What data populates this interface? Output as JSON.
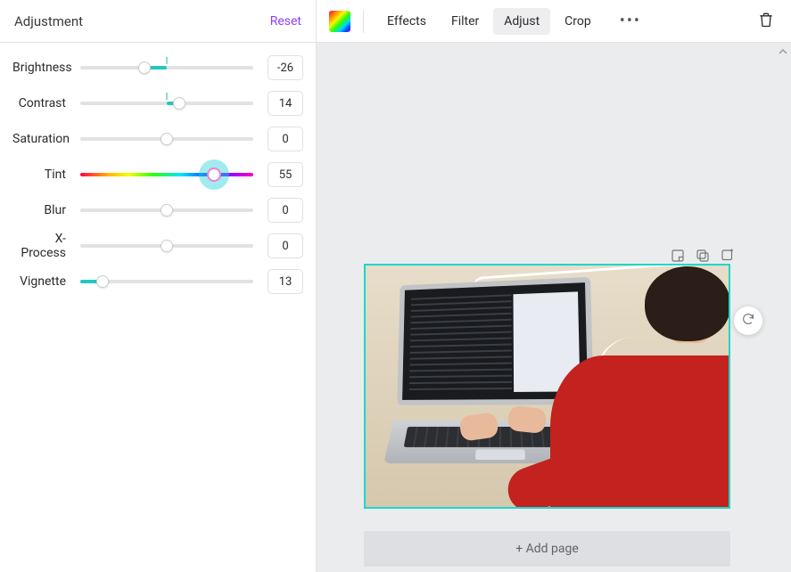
{
  "panel": {
    "title": "Adjustment",
    "reset_label": "Reset"
  },
  "sliders": {
    "brightness": {
      "label": "Brightness",
      "value": "-26",
      "min": -100,
      "max": 100,
      "v": -26,
      "origin": "center"
    },
    "contrast": {
      "label": "Contrast",
      "value": "14",
      "min": -100,
      "max": 100,
      "v": 14,
      "origin": "center"
    },
    "saturation": {
      "label": "Saturation",
      "value": "0",
      "min": -100,
      "max": 100,
      "v": 0,
      "origin": "center"
    },
    "tint": {
      "label": "Tint",
      "value": "55",
      "min": -100,
      "max": 100,
      "v": 55,
      "origin": "left"
    },
    "blur": {
      "label": "Blur",
      "value": "0",
      "min": -100,
      "max": 100,
      "v": 0,
      "origin": "center"
    },
    "xprocess": {
      "label": "X-Process",
      "value": "0",
      "min": -100,
      "max": 100,
      "v": 0,
      "origin": "center"
    },
    "vignette": {
      "label": "Vignette",
      "value": "13",
      "min": 0,
      "max": 100,
      "v": 13,
      "origin": "left"
    }
  },
  "toolbar": {
    "effects": "Effects",
    "filter": "Filter",
    "adjust": "Adjust",
    "crop": "Crop",
    "more": "•••"
  },
  "canvas": {
    "add_page_label": "+ Add page"
  }
}
